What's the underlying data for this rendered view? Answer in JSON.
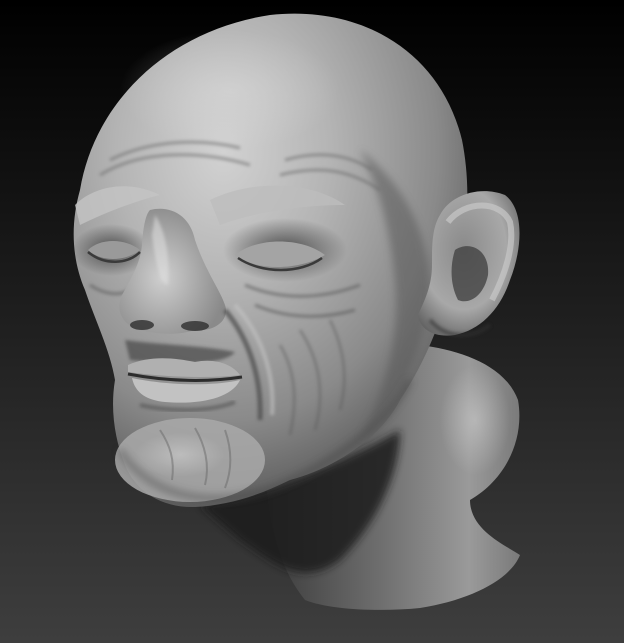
{
  "scene": {
    "subject": "sculpted-head",
    "colors": {
      "background_top": "#000000",
      "background_bottom": "#3e3e3e",
      "clay_highlight": "#d2d2d2",
      "clay_mid": "#9a9a9a",
      "clay_shadow": "#4a4a4a",
      "clay_deep": "#222222"
    }
  }
}
